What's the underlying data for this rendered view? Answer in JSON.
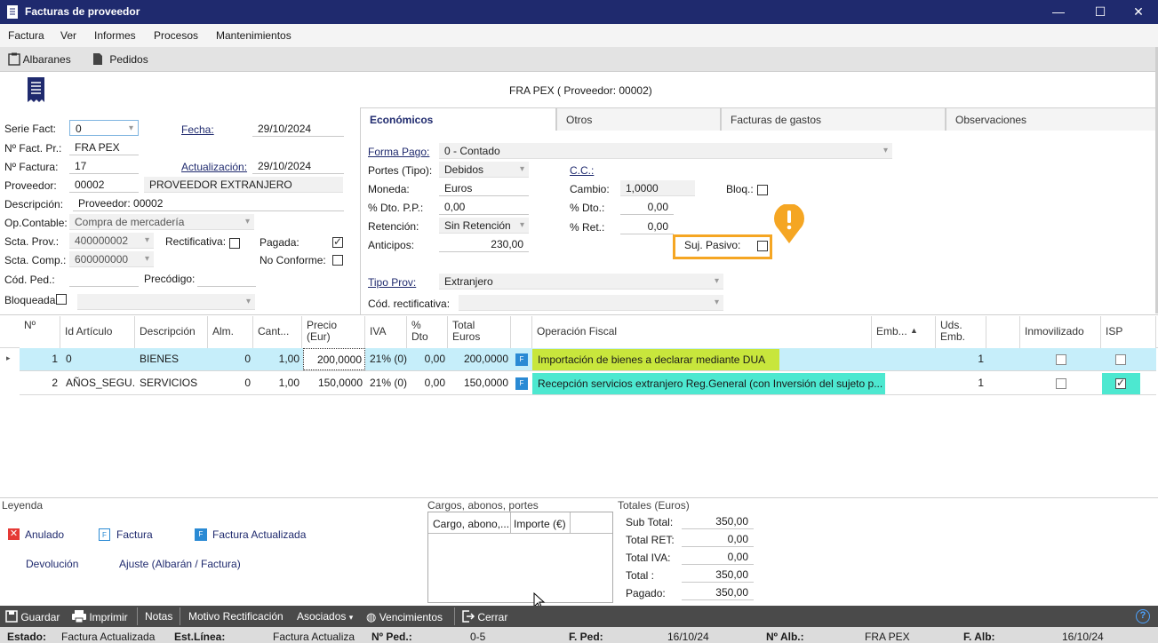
{
  "window": {
    "title": "Facturas de proveedor",
    "min": "—",
    "max": "☐",
    "close": "✕"
  },
  "menu": [
    "Factura",
    "Ver",
    "Informes",
    "Procesos",
    "Mantenimientos"
  ],
  "toolbar": {
    "albaranes": "Albaranes",
    "pedidos": "Pedidos"
  },
  "header_title": "FRA PEX ( Proveedor: 00002)",
  "form": {
    "serie_label": "Serie Fact:",
    "serie": "0",
    "nfactpr_label": "Nº Fact. Pr.:",
    "nfactpr": "FRA PEX",
    "nfactura_label": "Nº Factura:",
    "nfactura": "17",
    "proveedor_label": "Proveedor:",
    "proveedor_code": "00002",
    "proveedor_name": "PROVEEDOR EXTRANJERO",
    "descripcion_label": "Descripción:",
    "descripcion": "Proveedor: 00002",
    "opcontable_label": "Op.Contable:",
    "opcontable": "Compra de mercadería",
    "sctaprov_label": "Scta. Prov.:",
    "sctaprov": "400000002",
    "sctacomp_label": "Scta. Comp.:",
    "sctacomp": "600000000",
    "codped_label": "Cód. Ped.:",
    "precodigo_label": "Precódigo:",
    "bloqueada_label": "Bloqueada",
    "rectificativa_label": "Rectificativa:",
    "pagada_label": "Pagada:",
    "noconforme_label": "No Conforme:",
    "fecha_label": "Fecha:",
    "fecha": "29/10/2024",
    "actualizacion_label": "Actualización:",
    "actualizacion": "29/10/2024"
  },
  "tabs": [
    "Económicos",
    "Otros",
    "Facturas de gastos",
    "Observaciones"
  ],
  "economicos": {
    "formapago_label": "Forma Pago:",
    "formapago": "0 - Contado",
    "portes_label": "Portes (Tipo):",
    "portes": "Debidos",
    "cc_label": "C.C.:",
    "moneda_label": "Moneda:",
    "moneda": "Euros",
    "cambio_label": "Cambio:",
    "cambio": "1,0000",
    "bloq_label": "Bloq.:",
    "dtopp_label": "% Dto. P.P.:",
    "dtopp": "0,00",
    "dto_label": "% Dto.:",
    "dto": "0,00",
    "retencion_label": "Retención:",
    "retencion": "Sin Retención",
    "ret_label": "% Ret.:",
    "ret": "0,00",
    "anticipos_label": "Anticipos:",
    "anticipos": "230,00",
    "sujpasivo_label": "Suj. Pasivo:",
    "tipoprov_label": "Tipo Prov:",
    "tipoprov": "Extranjero",
    "codrect_label": "Cód. rectificativa:"
  },
  "grid": {
    "headers": [
      "Nº",
      "Id Artículo",
      "Descripción",
      "Alm.",
      "Cant...",
      "Precio (Eur)",
      "IVA",
      "% Dto",
      "Total Euros",
      "",
      "Operación Fiscal",
      "Emb...",
      "Uds. Emb.",
      "",
      "Inmovilizado",
      "ISP"
    ],
    "rows": [
      {
        "n": "1",
        "id": "0",
        "desc": "BIENES",
        "alm": "0",
        "cant": "1,00",
        "precio": "200,0000",
        "iva": "21% (0)",
        "dto": "0,00",
        "total": "200,0000",
        "f": "F",
        "op": "Importación de bienes a declarar mediante DUA",
        "emb": "",
        "uds": "1",
        "isp": false
      },
      {
        "n": "2",
        "id": "AÑOS_SEGU...",
        "desc": "SERVICIOS",
        "alm": "0",
        "cant": "1,00",
        "precio": "150,0000",
        "iva": "21% (0)",
        "dto": "0,00",
        "total": "150,0000",
        "f": "F",
        "op": "Recepción servicios extranjero Reg.General (con Inversión del sujeto p...",
        "emb": "",
        "uds": "1",
        "isp": true
      }
    ]
  },
  "leyenda": {
    "title": "Leyenda",
    "anulado": "Anulado",
    "factura": "Factura",
    "factura_act": "Factura Actualizada",
    "devolucion": "Devolución",
    "ajuste": "Ajuste  (Albarán / Factura)"
  },
  "cargos": {
    "title": "Cargos, abonos, portes",
    "col1": "Cargo, abono,...",
    "col2": "Importe (€)"
  },
  "totales": {
    "title": "Totales (Euros)",
    "subtotal_label": "Sub Total:",
    "subtotal": "350,00",
    "ret_label": "Total RET:",
    "ret": "0,00",
    "iva_label": "Total IVA:",
    "iva": "0,00",
    "total_label": "Total :",
    "total": "350,00",
    "pagado_label": "Pagado:",
    "pagado": "350,00"
  },
  "actions": {
    "guardar": "Guardar",
    "imprimir": "Imprimir",
    "notas": "Notas",
    "motivo": "Motivo Rectificación",
    "asociados": "Asociados",
    "vencimientos": "Vencimientos",
    "cerrar": "Cerrar",
    "help": "?"
  },
  "status": {
    "estado_label": "Estado:",
    "estado": "Factura Actualizada",
    "estlinea_label": "Est.Línea:",
    "estlinea": "Factura Actualiza",
    "nped_label": "Nº Ped.:",
    "nped": "0-5",
    "fped_label": "F. Ped:",
    "fped": "16/10/24",
    "nalb_label": "Nº Alb.:",
    "nalb": "FRA PEX",
    "falb_label": "F. Alb:",
    "falb": "16/10/24"
  },
  "colors": {
    "titlebar": "#1f2a6e",
    "row_selected": "#c6eefa",
    "op_green": "#c8e63c",
    "op_cyan": "#4de8d0",
    "warn": "#f5a623"
  }
}
